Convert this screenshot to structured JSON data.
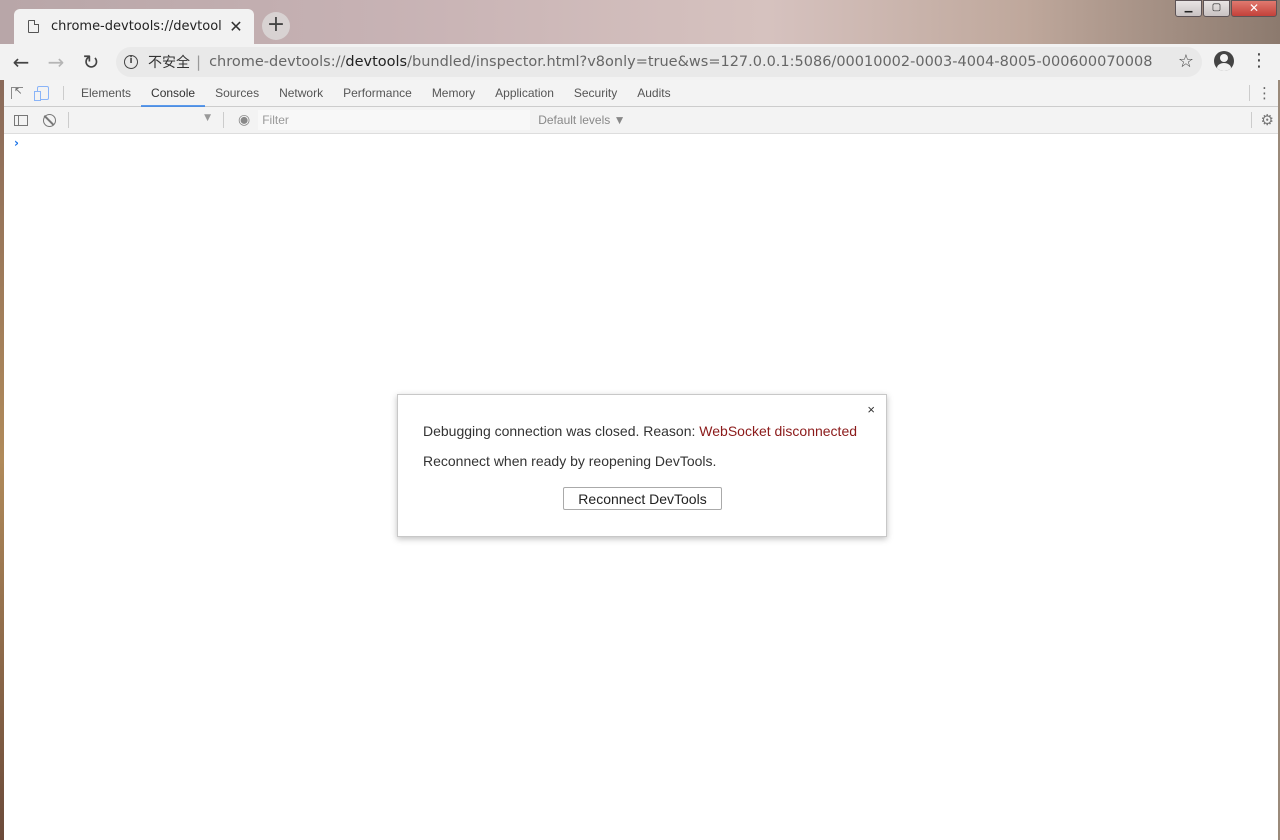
{
  "browser": {
    "tab_title": "chrome-devtools://devtools/bundled/inspector.html",
    "tab_close": "✕",
    "new_tab": "+",
    "window_controls": {
      "minimize": "▁",
      "maximize": "▢",
      "close": "✕"
    }
  },
  "toolbar": {
    "back": "←",
    "forward": "→",
    "reload": "↻",
    "security_label": "不安全",
    "separator": "|",
    "url_scheme": "chrome-devtools://",
    "url_host": "devtools",
    "url_path": "/bundled/inspector.html?v8only=true&ws=127.0.0.1:5086/00010002-0003-4004-8005-000600070008",
    "star": "☆",
    "menu": "⋮"
  },
  "devtools": {
    "tabs": [
      "Elements",
      "Console",
      "Sources",
      "Network",
      "Performance",
      "Memory",
      "Application",
      "Security",
      "Audits"
    ],
    "active_tab": "Console",
    "more": "⋮"
  },
  "console": {
    "context_value": "",
    "context_arrow": "▼",
    "eye": "◉",
    "filter_placeholder": "Filter",
    "levels_label": "Default levels ▼",
    "settings": "⚙",
    "prompt": "›"
  },
  "dialog": {
    "close": "×",
    "message_prefix": "Debugging connection was closed. Reason: ",
    "reason": "WebSocket disconnected",
    "subtext": "Reconnect when ready by reopening DevTools.",
    "button_label": "Reconnect DevTools"
  }
}
